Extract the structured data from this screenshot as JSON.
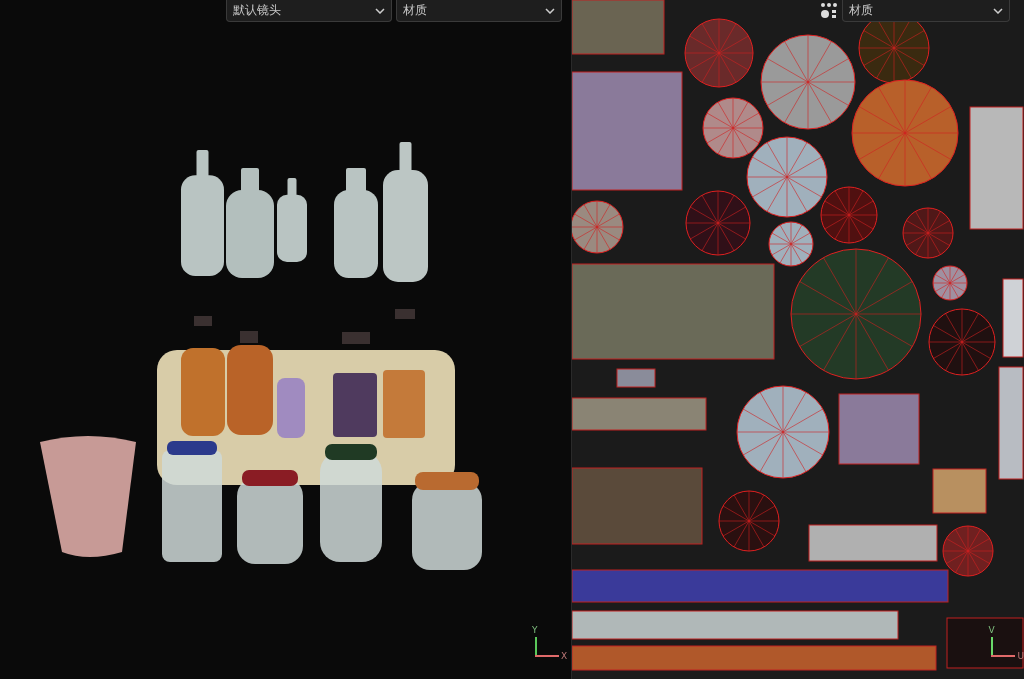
{
  "viewport": {
    "camera_dropdown": "默认镜头",
    "shading_dropdown": "材质",
    "axis": {
      "vertical": "Y",
      "horizontal": "X"
    }
  },
  "uv_editor": {
    "shading_dropdown": "材质",
    "axis": {
      "vertical": "V",
      "horizontal": "U"
    }
  }
}
